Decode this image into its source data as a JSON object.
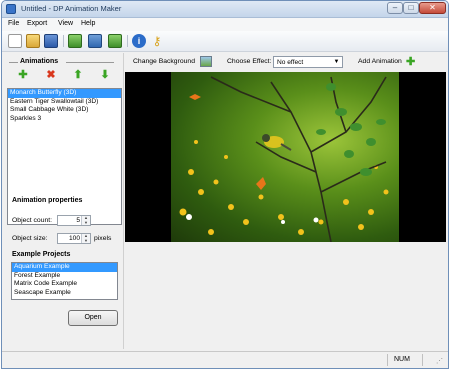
{
  "window": {
    "title": "Untitled - DP Animation Maker"
  },
  "menu": [
    "File",
    "Export",
    "View",
    "Help"
  ],
  "toolbar": {
    "change_background_label": "Change Background",
    "choose_effect_label": "Choose Effect:",
    "effect_value": "No effect",
    "add_animation_label": "Add Animation"
  },
  "animations": {
    "title": "Animations",
    "items": [
      "Monarch Butterfly (3D)",
      "Eastern Tiger Swallowtail (3D)",
      "Small Cabbage White (3D)",
      "Sparkles 3"
    ],
    "selected_index": 0
  },
  "properties": {
    "title": "Animation properties",
    "count_label": "Object count:",
    "count_value": "5",
    "size_label": "Object size:",
    "size_value": "100",
    "size_unit": "pixels"
  },
  "examples": {
    "title": "Example Projects",
    "items": [
      "Aquarium Example",
      "Forest Example",
      "Matrix Code Example",
      "Seascape Example"
    ],
    "selected_index": 0,
    "open_label": "Open"
  },
  "status": {
    "num": "NUM"
  },
  "colors": {
    "selection": "#3399ff",
    "add_green": "#3aa524",
    "remove_red": "#d9381e"
  }
}
